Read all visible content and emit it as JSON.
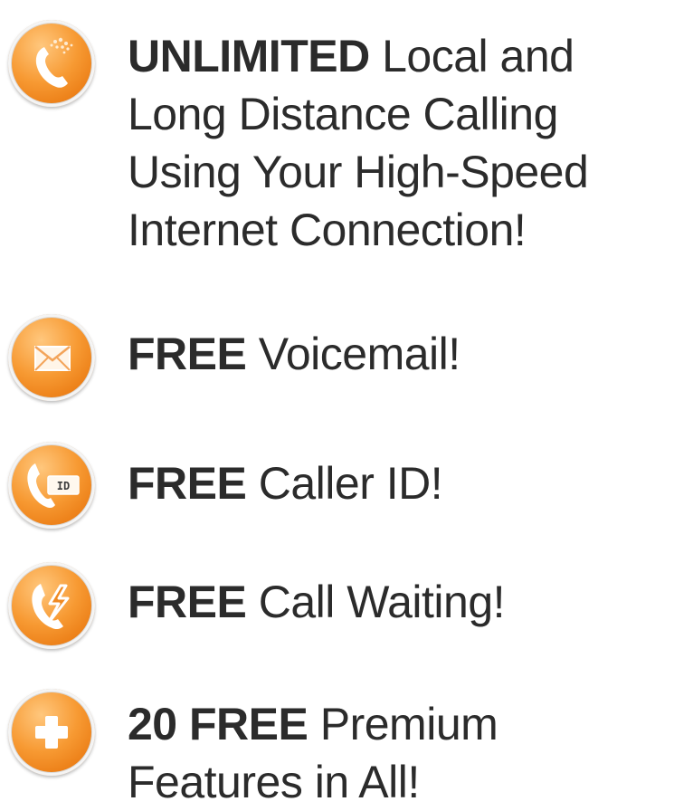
{
  "features": [
    {
      "icon": "phone-icon",
      "bold": "UNLIMITED",
      "lines": [
        " Local and",
        "Long Distance Calling",
        "Using Your High-Speed",
        "Internet Connection!"
      ]
    },
    {
      "icon": "envelope-icon",
      "bold": "FREE",
      "lines": [
        " Voicemail!"
      ]
    },
    {
      "icon": "caller-id-icon",
      "bold": "FREE",
      "badge": "ID",
      "lines": [
        " Caller ID!"
      ]
    },
    {
      "icon": "call-waiting-icon",
      "bold": "FREE",
      "lines": [
        " Call Waiting!"
      ]
    },
    {
      "icon": "plus-icon",
      "bold": "20 FREE",
      "lines": [
        " Premium",
        "Features in All!"
      ]
    }
  ],
  "colors": {
    "accent": "#f58c1f",
    "text": "#2b2b2b"
  }
}
